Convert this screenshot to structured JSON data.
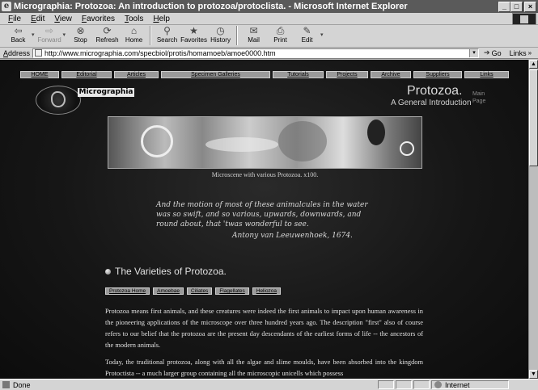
{
  "window": {
    "title": "Micrographia: Protozoa: An introduction to protozoa/protoclista. - Microsoft Internet Explorer",
    "min": "_",
    "max": "□",
    "close": "×"
  },
  "menu": [
    "File",
    "Edit",
    "View",
    "Favorites",
    "Tools",
    "Help"
  ],
  "toolbar": {
    "back": "Back",
    "forward": "Forward",
    "stop": "Stop",
    "refresh": "Refresh",
    "home": "Home",
    "search": "Search",
    "favorites": "Favorites",
    "history": "History",
    "mail": "Mail",
    "print": "Print",
    "edit": "Edit"
  },
  "address": {
    "label": "Address",
    "url": "http://www.micrographia.com/specbiol/protis/homamoeb/amoe0000.htm",
    "go": "Go",
    "links": "Links"
  },
  "site": {
    "nav": [
      "HOME",
      "Editorial",
      "Articles",
      "Specimen Galleries",
      "Tutorials",
      "Projects",
      "Archive",
      "Suppliers",
      "Links"
    ],
    "logo_label": "Micrographia",
    "title": "Protozoa.",
    "subtitle": "A General Introduction",
    "main_page_line1": "Main",
    "main_page_line2": "Page",
    "hero_caption": "Microscene with various Protozoa. x100.",
    "quote_lines": [
      "And the motion of most of these animalcules in the water",
      "was so swift, and so various, upwards, downwards, and",
      "round about, that 'twas wonderful to see."
    ],
    "quote_attr": "Antony van Leeuwenhoek, 1674.",
    "section_title": "The Varieties of Protozoa.",
    "subnav": [
      "Protozoa Home",
      "Amoebae",
      "Ciliates",
      "Flagellates",
      "Heliozoa"
    ],
    "para1": "Protozoa means first animals, and these creatures were indeed the first animals to impact upon human awareness in the pioneering applications of the microscope over three hundred years ago. The description \"first\" also of course refers to our belief that the protozoa are the present day descendants of the earliest forms of life -- the ancestors of the modern animals.",
    "para2": "Today, the traditional protozoa, along with all the algae and slime moulds, have been absorbed into the kingdom Protoctista -- a much larger group containing all the microscopic unicells which possess"
  },
  "status": {
    "text": "Done",
    "zone": "Internet"
  },
  "icons": {
    "back": "arrow-left-icon",
    "forward": "arrow-right-icon",
    "stop": "stop-icon",
    "refresh": "refresh-icon",
    "home": "home-icon",
    "search": "search-icon",
    "favorites": "favorites-icon",
    "history": "history-icon",
    "mail": "mail-icon",
    "print": "print-icon",
    "edit": "edit-icon"
  }
}
